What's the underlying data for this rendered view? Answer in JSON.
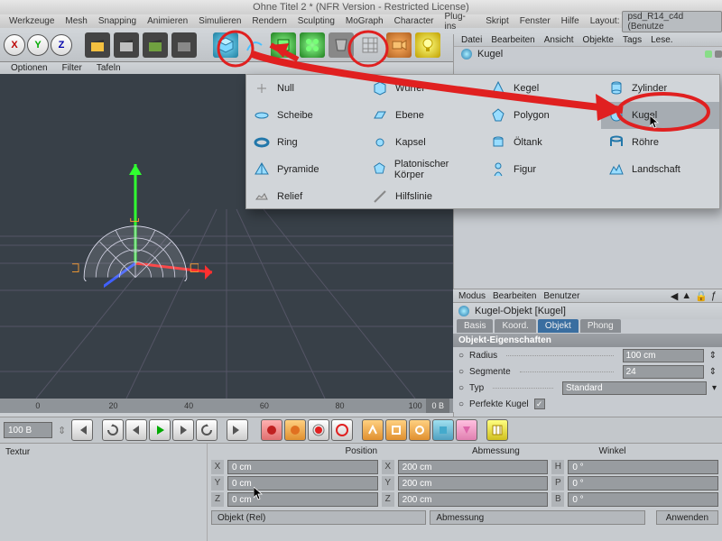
{
  "window": {
    "title": "Ohne Titel 2 * (NFR Version - Restricted License)"
  },
  "menubar": {
    "items": [
      "Werkzeuge",
      "Mesh",
      "Snapping",
      "Animieren",
      "Simulieren",
      "Rendern",
      "Sculpting",
      "MoGraph",
      "Character",
      "Plug-ins",
      "Skript",
      "Fenster",
      "Hilfe"
    ],
    "layout_label": "Layout:",
    "layout_value": "psd_R14_c4d (Benutze"
  },
  "mainbar": {
    "xyz": [
      "X",
      "Y",
      "Z"
    ]
  },
  "right_top": {
    "menu": [
      "Datei",
      "Bearbeiten",
      "Ansicht",
      "Objekte",
      "Tags",
      "Lese."
    ],
    "object": "Kugel"
  },
  "subbar": {
    "items": [
      "Optionen",
      "Filter",
      "Tafeln"
    ]
  },
  "palette": {
    "items": [
      {
        "label": "Null"
      },
      {
        "label": "Würfel"
      },
      {
        "label": "Kegel"
      },
      {
        "label": "Zylinder"
      },
      {
        "label": "Scheibe"
      },
      {
        "label": "Ebene"
      },
      {
        "label": "Polygon"
      },
      {
        "label": "Kugel"
      },
      {
        "label": "Ring"
      },
      {
        "label": "Kapsel"
      },
      {
        "label": "Öltank"
      },
      {
        "label": "Röhre"
      },
      {
        "label": "Pyramide"
      },
      {
        "label": "Platonischer Körper"
      },
      {
        "label": "Figur"
      },
      {
        "label": "Landschaft"
      },
      {
        "label": "Relief"
      },
      {
        "label": "Hilfslinie"
      }
    ]
  },
  "ruler": {
    "ticks": [
      "0",
      "20",
      "40",
      "60",
      "80",
      "100"
    ],
    "current": "0 B"
  },
  "playbar": {
    "frame": "100 B"
  },
  "lower": {
    "left_title": "Textur",
    "headers": [
      "Position",
      "Abmessung",
      "Winkel"
    ],
    "rows": [
      {
        "axis": "X",
        "pos": "0 cm",
        "dim": "200 cm",
        "ang_lbl": "H",
        "ang": "0 °"
      },
      {
        "axis": "Y",
        "pos": "0 cm",
        "dim": "200 cm",
        "ang_lbl": "P",
        "ang": "0 °"
      },
      {
        "axis": "Z",
        "pos": "0 cm",
        "dim": "200 cm",
        "ang_lbl": "B",
        "ang": "0 °"
      }
    ],
    "drop1": "Objekt (Rel)",
    "drop2": "Abmessung",
    "apply": "Anwenden"
  },
  "amgr": {
    "menu": [
      "Modus",
      "Bearbeiten",
      "Benutzer"
    ],
    "title": "Kugel-Objekt [Kugel]",
    "tabs": [
      "Basis",
      "Koord.",
      "Objekt",
      "Phong"
    ],
    "subtitle": "Objekt-Eigenschaften",
    "rows": [
      {
        "label": "Radius",
        "value": "100 cm",
        "type": "num"
      },
      {
        "label": "Segmente",
        "value": "24",
        "type": "num"
      },
      {
        "label": "Typ",
        "value": "Standard",
        "type": "drop"
      },
      {
        "label": "Perfekte Kugel",
        "value": "✓",
        "type": "check"
      }
    ]
  }
}
